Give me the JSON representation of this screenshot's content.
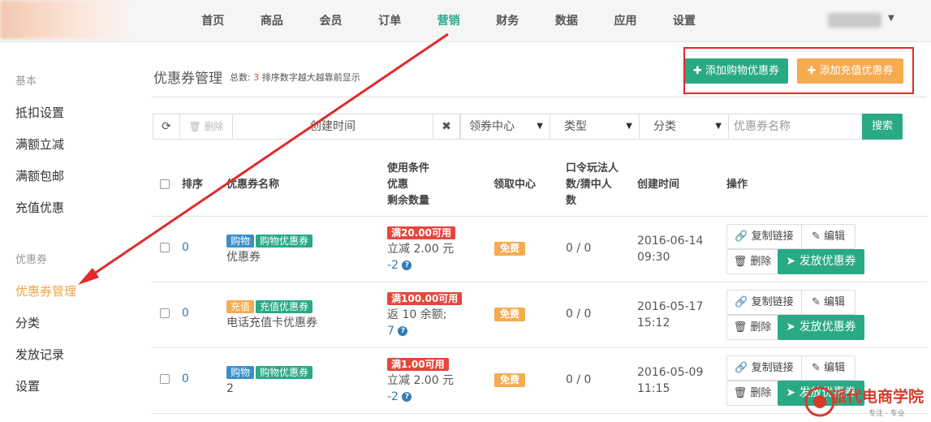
{
  "nav": {
    "items": [
      "首页",
      "商品",
      "会员",
      "订单",
      "营销",
      "财务",
      "数据",
      "应用",
      "设置"
    ],
    "active_index": 4,
    "accent": "#2aa985"
  },
  "sidebar": {
    "sections": [
      {
        "title": "基本",
        "items": [
          "抵扣设置",
          "满额立减",
          "满额包邮",
          "充值优惠"
        ]
      },
      {
        "title": "优惠券",
        "items": [
          "优惠券管理",
          "分类",
          "发放记录",
          "设置"
        ]
      }
    ],
    "active": "优惠券管理"
  },
  "header": {
    "title": "优惠券管理",
    "total_label": "总数:",
    "total": "3",
    "note": "排序数字越大越靠前显示",
    "add_shop_btn": "添加购物优惠券",
    "add_recharge_btn": "添加充值优惠券"
  },
  "filters": {
    "delete_btn": "删除",
    "date_placeholder": "创建时间",
    "center_select": "领券中心",
    "type_select": "类型",
    "category_select": "分类",
    "name_placeholder": "优惠券名称",
    "search_btn": "搜索"
  },
  "table": {
    "headers": {
      "sort": "排序",
      "name": "优惠券名称",
      "condition": [
        "使用条件",
        "优惠",
        "剩余数量"
      ],
      "center": "领取中心",
      "password": [
        "口令玩法人",
        "数/猜中人",
        "数"
      ],
      "created": "创建时间",
      "actions": "操作"
    },
    "rows": [
      {
        "sort": "0",
        "type_tag": "购物",
        "type_color": "#3a8fc9",
        "cat_tag": "购物优惠券",
        "name": "优惠券",
        "cond": "满20.00可用",
        "benefit": "立减 2.00 元",
        "remain": "-2",
        "center": "免费",
        "password": "0 / 0",
        "date": "2016-06-14",
        "time": "09:30"
      },
      {
        "sort": "0",
        "type_tag": "充值",
        "type_color": "#f5ab50",
        "cat_tag": "充值优惠券",
        "name": "电话充值卡优惠券",
        "cond": "满100.00可用",
        "benefit": "返 10 余额;",
        "remain": "7",
        "center": "免费",
        "password": "0 / 0",
        "date": "2016-05-17",
        "time": "15:12"
      },
      {
        "sort": "0",
        "type_tag": "购物",
        "type_color": "#3a8fc9",
        "cat_tag": "购物优惠券",
        "name": "2",
        "cond": "满1.00可用",
        "benefit": "立减 2.00 元",
        "remain": "-2",
        "center": "免费",
        "password": "0 / 0",
        "date": "2016-05-09",
        "time": "11:15"
      }
    ],
    "actions": {
      "copy": "复制链接",
      "edit": "编辑",
      "delete": "删除",
      "issue": "发放优惠券"
    }
  },
  "watermark": {
    "text": "派代电商学院",
    "sub": "专注 · 专业"
  },
  "annotation_colors": {
    "arrow": "#e02a2a",
    "box": "#e02a2a"
  }
}
